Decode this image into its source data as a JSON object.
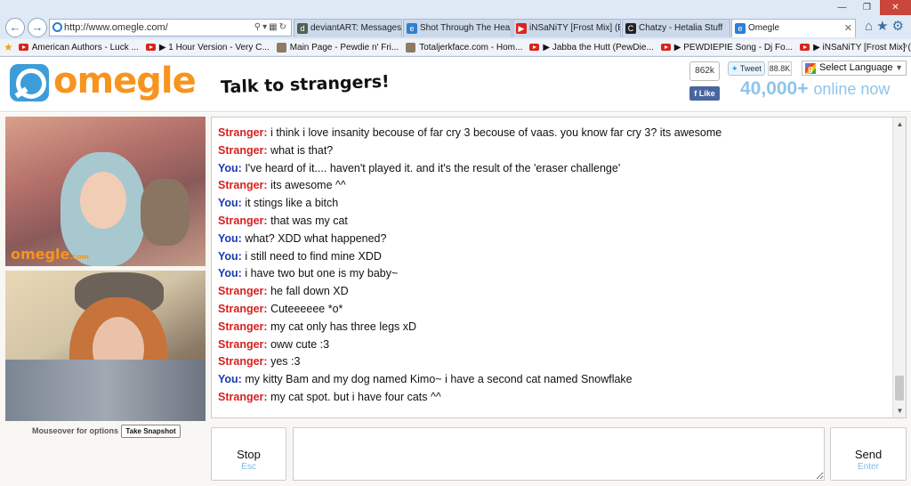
{
  "browser": {
    "url": "http://www.omegle.com/",
    "tabs": [
      {
        "label": "deviantART: Messages#...",
        "icon": "deviantart-icon"
      },
      {
        "label": "Shot Through The Hear...",
        "icon": "ie-page-icon"
      },
      {
        "label": "iNSaNiTY [Frost Mix] (E...",
        "icon": "youtube-icon"
      },
      {
        "label": "Chatzy - Hetalia Stuff",
        "icon": "chatzy-icon"
      },
      {
        "label": "Omegle",
        "icon": "ie-page-icon",
        "active": true
      }
    ],
    "favorites": [
      {
        "label": "American Authors - Luck ...",
        "icon": "youtube-icon"
      },
      {
        "label": "▶ 1 Hour Version - Very C...",
        "icon": "youtube-icon"
      },
      {
        "label": "Main Page - Pewdie n' Fri...",
        "icon": "wiki-icon"
      },
      {
        "label": "Totaljerkface.com - Hom...",
        "icon": "page-icon"
      },
      {
        "label": "▶ Jabba the Hutt (PewDie...",
        "icon": "youtube-icon"
      },
      {
        "label": "▶ PEWDIEPIE Song - Dj Fo...",
        "icon": "youtube-icon"
      },
      {
        "label": "▶ iNSaNiTY [Frost Mix] (E...",
        "icon": "youtube-icon"
      }
    ]
  },
  "header": {
    "logo_text": "omegle",
    "tagline": "Talk to strangers!",
    "like_count": "862k",
    "like_label": "Like",
    "tweet_label": "Tweet",
    "tweet_count": "88.8K",
    "language_label": "Select Language",
    "online_count": "40,000+",
    "online_label": "online now"
  },
  "video": {
    "stranger_watermark": "omegle",
    "stranger_watermark_suffix": ".com",
    "mouseover_label": "Mouseover for options",
    "snapshot_label": "Take Snapshot"
  },
  "chat": {
    "messages": [
      {
        "who": "Stranger:",
        "role": "stranger",
        "text": "i think i love insanity becouse of far cry 3 becouse of vaas. you know far cry 3? its awesome"
      },
      {
        "who": "Stranger:",
        "role": "stranger",
        "text": "what is that?"
      },
      {
        "who": "You:",
        "role": "you",
        "text": "I've heard of it.... haven't played it. and it's the result of the 'eraser challenge'"
      },
      {
        "who": "Stranger:",
        "role": "stranger",
        "text": "its awesome ^^"
      },
      {
        "who": "You:",
        "role": "you",
        "text": "it stings like a bitch"
      },
      {
        "who": "Stranger:",
        "role": "stranger",
        "text": "that was my cat"
      },
      {
        "who": "You:",
        "role": "you",
        "text": "what? XDD what happened?"
      },
      {
        "who": "You:",
        "role": "you",
        "text": "i still need to find mine XDD"
      },
      {
        "who": "You:",
        "role": "you",
        "text": "i have two but one is my baby~"
      },
      {
        "who": "Stranger:",
        "role": "stranger",
        "text": "he fall down XD"
      },
      {
        "who": "Stranger:",
        "role": "stranger",
        "text": "Cuteeeeee *o*"
      },
      {
        "who": "Stranger:",
        "role": "stranger",
        "text": "my cat only has three legs xD"
      },
      {
        "who": "Stranger:",
        "role": "stranger",
        "text": "oww cute :3"
      },
      {
        "who": "Stranger:",
        "role": "stranger",
        "text": "yes :3"
      },
      {
        "who": "You:",
        "role": "you",
        "text": "my kitty Bam and my dog named Kimo~ i have a second cat named Snowflake"
      },
      {
        "who": "Stranger:",
        "role": "stranger",
        "text": "my cat spot. but i have four cats ^^"
      }
    ],
    "stop_label": "Stop",
    "stop_hint": "Esc",
    "send_label": "Send",
    "send_hint": "Enter",
    "input_value": ""
  },
  "colors": {
    "omegle_orange": "#f8941d",
    "omegle_blue": "#3c9dd8",
    "stranger_red": "#d81f1f",
    "you_blue": "#1a3bb5",
    "online_blue": "#8ec5ea"
  }
}
